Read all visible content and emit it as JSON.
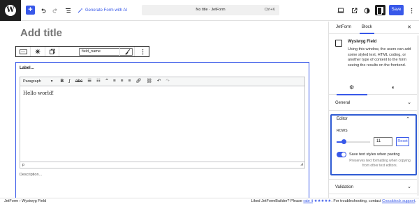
{
  "toolbar": {
    "add_block": "+",
    "generate_ai_label": "Generate Form with AI",
    "document_title": "No title · JetForm",
    "shortcut": "Ctrl+K",
    "save_label": "Save"
  },
  "editor": {
    "title_placeholder": "Add title",
    "field_name_value": "field_name",
    "field_label": "Label...",
    "format_select": "Paragraph",
    "content": "Hello world!",
    "status_path": "p",
    "description": "Description..."
  },
  "sidebar": {
    "tabs": [
      "JetForm",
      "Block"
    ],
    "active_tab": "Block",
    "block_name": "Wysiwyg Field",
    "block_description": "Using this window, the users can add some styled text, HTML coding, or another type of content to the form seeing the results on the frontend.",
    "panels": {
      "general": "General",
      "editor": "Editor",
      "validation": "Validation"
    },
    "rows_label": "ROWS",
    "rows_value": "11",
    "rows_fraction": 0.22,
    "reset_label": "Reset",
    "toggle_label": "Save text styles when pasting",
    "toggle_on": true,
    "toggle_help": "Preserves text formatting when copying from other text editors."
  },
  "footer": {
    "crumbs": [
      "JetForm",
      "Wysiwyg Field"
    ],
    "message_prefix": "Liked JetFormBuilder? Please ",
    "rate_text": "rate it",
    "stars": "★★★★★",
    "message_suffix": ". For troubleshooting, contact ",
    "support_link": "Crocoblock support",
    "message_end": "."
  },
  "colors": {
    "accent": "#3858e9",
    "highlight_border": "#2f5bd3",
    "dark": "#1e1e1e"
  }
}
